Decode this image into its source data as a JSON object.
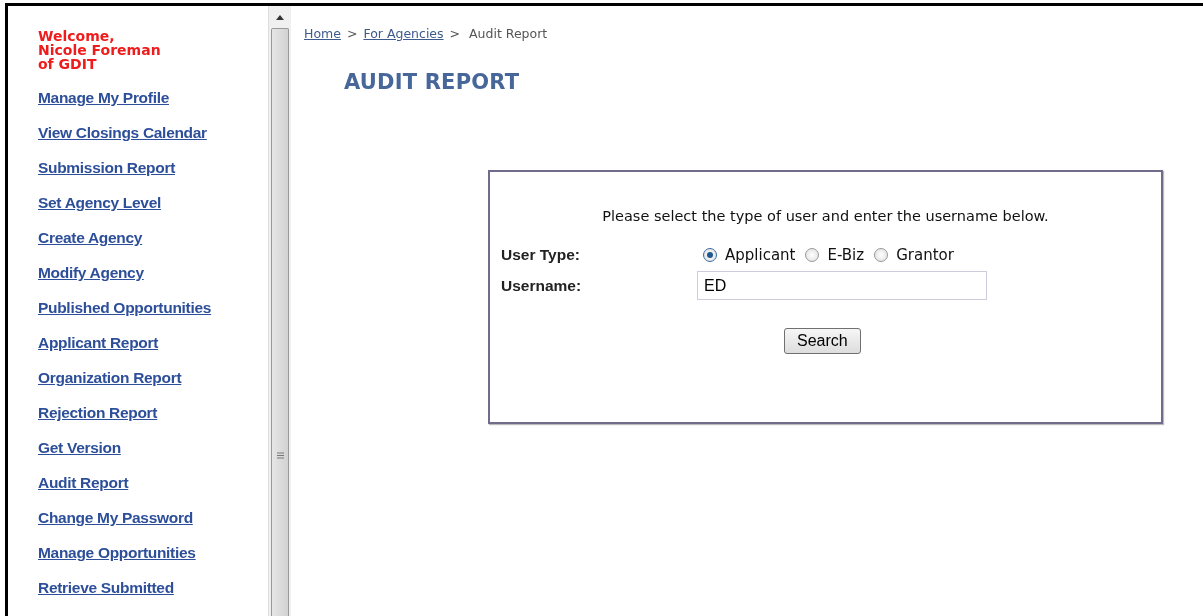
{
  "sidebar": {
    "welcome": [
      "Welcome,",
      "Nicole Foreman",
      "of GDIT"
    ],
    "links": [
      "Manage My Profile",
      "View Closings Calendar",
      "Submission Report",
      "Set Agency Level",
      "Create Agency",
      "Modify Agency",
      "Published Opportunities",
      "Applicant Report",
      "Organization Report",
      "Rejection Report",
      "Get Version",
      "Audit Report",
      "Change My Password",
      "Manage Opportunities",
      "Retrieve Submitted"
    ]
  },
  "breadcrumb": {
    "links": [
      "Home",
      "For Agencies"
    ],
    "separator": ">",
    "current": "Audit Report"
  },
  "heading": "AUDIT REPORT",
  "form": {
    "instructions": "Please select the type of user and enter the username below.",
    "user_type": {
      "label": "User Type:",
      "options": [
        {
          "label": "Applicant",
          "selected": true
        },
        {
          "label": "E-Biz",
          "selected": false
        },
        {
          "label": "Grantor",
          "selected": false
        }
      ]
    },
    "username": {
      "label": "Username:",
      "value": "ED"
    },
    "button": "Search"
  }
}
